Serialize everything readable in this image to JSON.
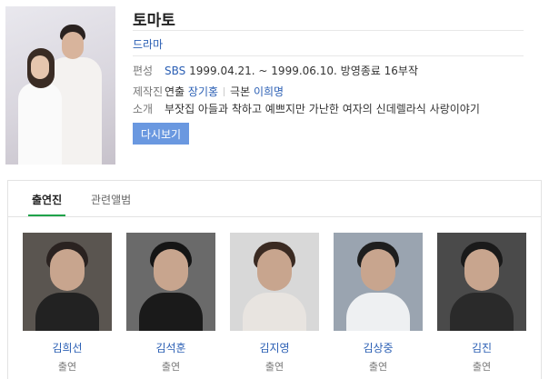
{
  "show": {
    "title": "토마토",
    "genre": "드라마",
    "broadcast": {
      "label": "편성",
      "channel": "SBS",
      "period": "1999.04.21. ~ 1999.06.10.",
      "status": "방영종료",
      "episodes": "16부작"
    },
    "production": {
      "label": "제작진",
      "director_label": "연출",
      "director": "장기홍",
      "writer_label": "극본",
      "writer": "이희명"
    },
    "intro": {
      "label": "소개",
      "text": "부잣집 아들과 착하고 예쁘지만 가난한 여자의 신데렐라식 사랑이야기"
    },
    "replay_button": "다시보기"
  },
  "tabs": [
    {
      "label": "출연진",
      "active": true
    },
    {
      "label": "관련앨범",
      "active": false
    }
  ],
  "cast": [
    {
      "name": "김희선",
      "role": "출연",
      "bg": "#5a5550",
      "hair": "#2a2220",
      "shirt": "#222222"
    },
    {
      "name": "김석훈",
      "role": "출연",
      "bg": "#6a6a6a",
      "hair": "#151515",
      "shirt": "#1a1a1a"
    },
    {
      "name": "김지영",
      "role": "출연",
      "bg": "#d8d8d8",
      "hair": "#3a2a22",
      "shirt": "#e8e4e0"
    },
    {
      "name": "김상중",
      "role": "출연",
      "bg": "#9aa4b0",
      "hair": "#1e1e1e",
      "shirt": "#eef0f2"
    },
    {
      "name": "김진",
      "role": "출연",
      "bg": "#4a4a4a",
      "hair": "#1a1a1a",
      "shirt": "#2a2a2a"
    }
  ],
  "colors": {
    "link": "#2b5fb4",
    "button": "#6a98e0",
    "tab_underline": "#1fa34a"
  }
}
